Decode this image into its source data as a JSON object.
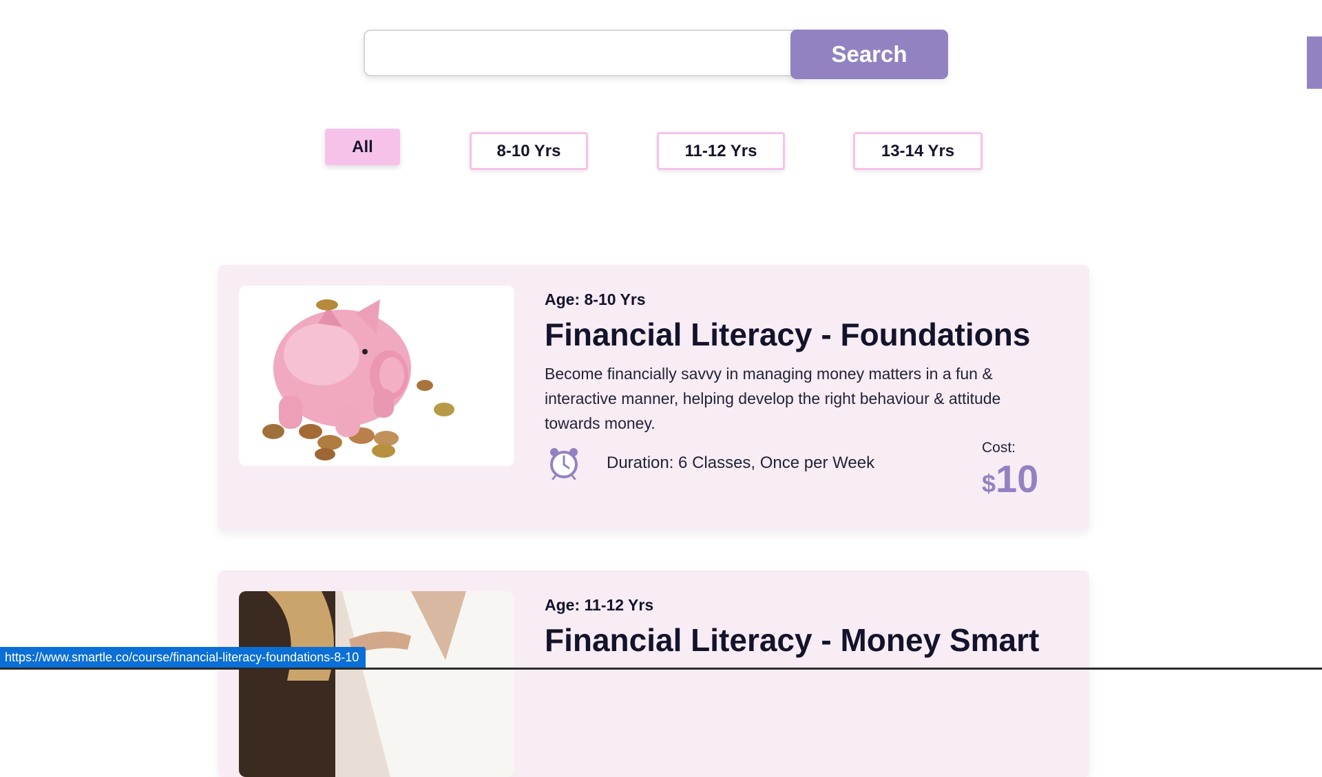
{
  "search": {
    "placeholder": "",
    "value": "",
    "button_label": "Search"
  },
  "filters": [
    {
      "label": "All",
      "active": true
    },
    {
      "label": "8-10 Yrs",
      "active": false
    },
    {
      "label": "11-12 Yrs",
      "active": false
    },
    {
      "label": "13-14 Yrs",
      "active": false
    }
  ],
  "courses": [
    {
      "age": "Age: 8-10 Yrs",
      "title": "Financial Literacy - Foundations",
      "description": "Become financially savvy in managing money matters in a fun & interactive manner, helping develop the right behaviour & attitude towards money.",
      "duration": "Duration: 6 Classes, Once per Week",
      "cost_label": "Cost:",
      "currency": "$",
      "price": "10",
      "image": "piggy-bank-with-coins"
    },
    {
      "age": "Age: 11-12 Yrs",
      "title": "Financial Literacy - Money Smart",
      "image": "person-handing-money"
    }
  ],
  "status_bar": {
    "url": "https://www.smartle.co/course/financial-literacy-foundations-8-10"
  },
  "colors": {
    "accent": "#9382c1",
    "pink": "#f7c2ea",
    "card_bg": "#f8ecf5",
    "status_blue": "#0a6fd6"
  }
}
